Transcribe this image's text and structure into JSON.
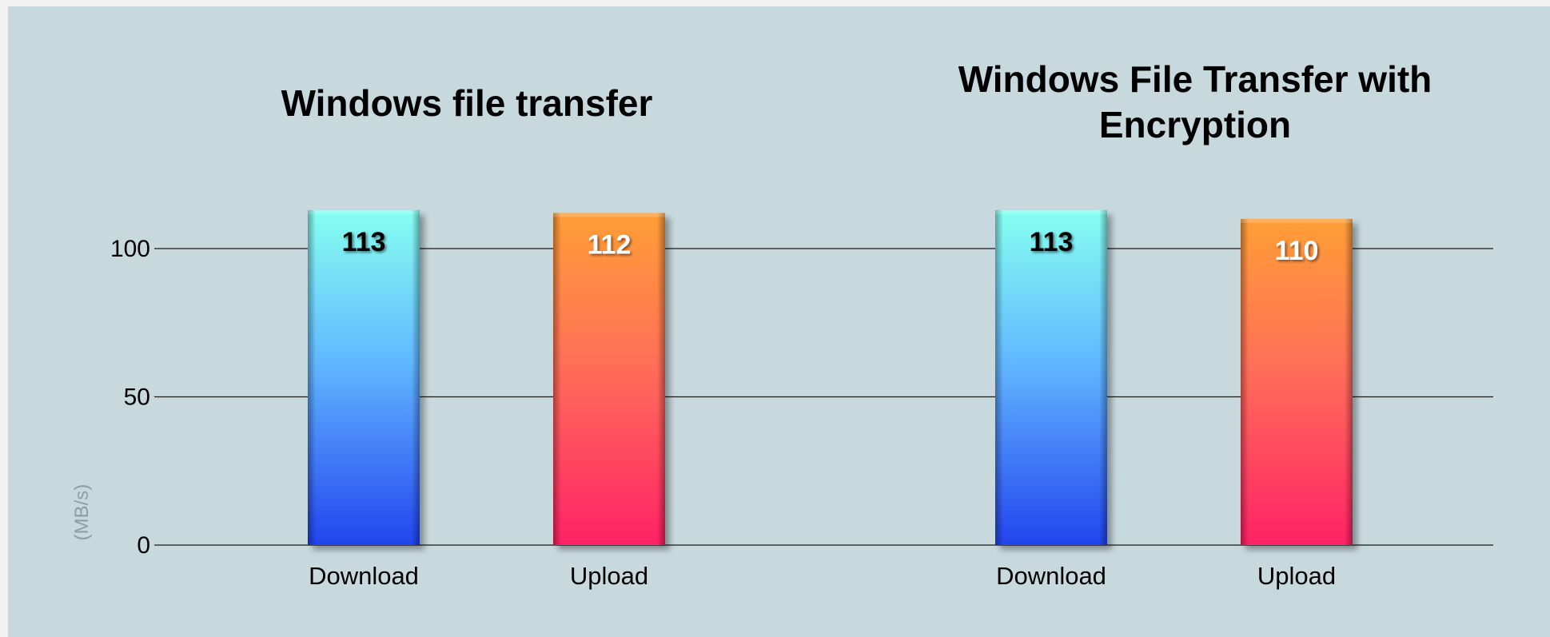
{
  "chart_data": {
    "type": "bar",
    "ylabel": "(MB/s)",
    "ylim": [
      0,
      100
    ],
    "yticks": [
      "0",
      "50",
      "100"
    ],
    "grid": true,
    "panels": [
      {
        "title_lines": [
          "Windows file transfer"
        ],
        "categories": [
          "Download",
          "Upload"
        ],
        "values": [
          113,
          112
        ],
        "labels": [
          "113",
          "112"
        ]
      },
      {
        "title_lines": [
          "Windows File Transfer with",
          "Encryption"
        ],
        "categories": [
          "Download",
          "Upload"
        ],
        "values": [
          113,
          110
        ],
        "labels": [
          "113",
          "110"
        ]
      }
    ]
  },
  "colors": {
    "download_top": "#86fff0",
    "download_mid": "#62b8ff",
    "download_bottom": "#2244ee",
    "upload_top": "#ff9e36",
    "upload_mid": "#ff6f58",
    "upload_bottom": "#ff2266",
    "download_label": "#000000",
    "upload_label": "#ffffff"
  }
}
